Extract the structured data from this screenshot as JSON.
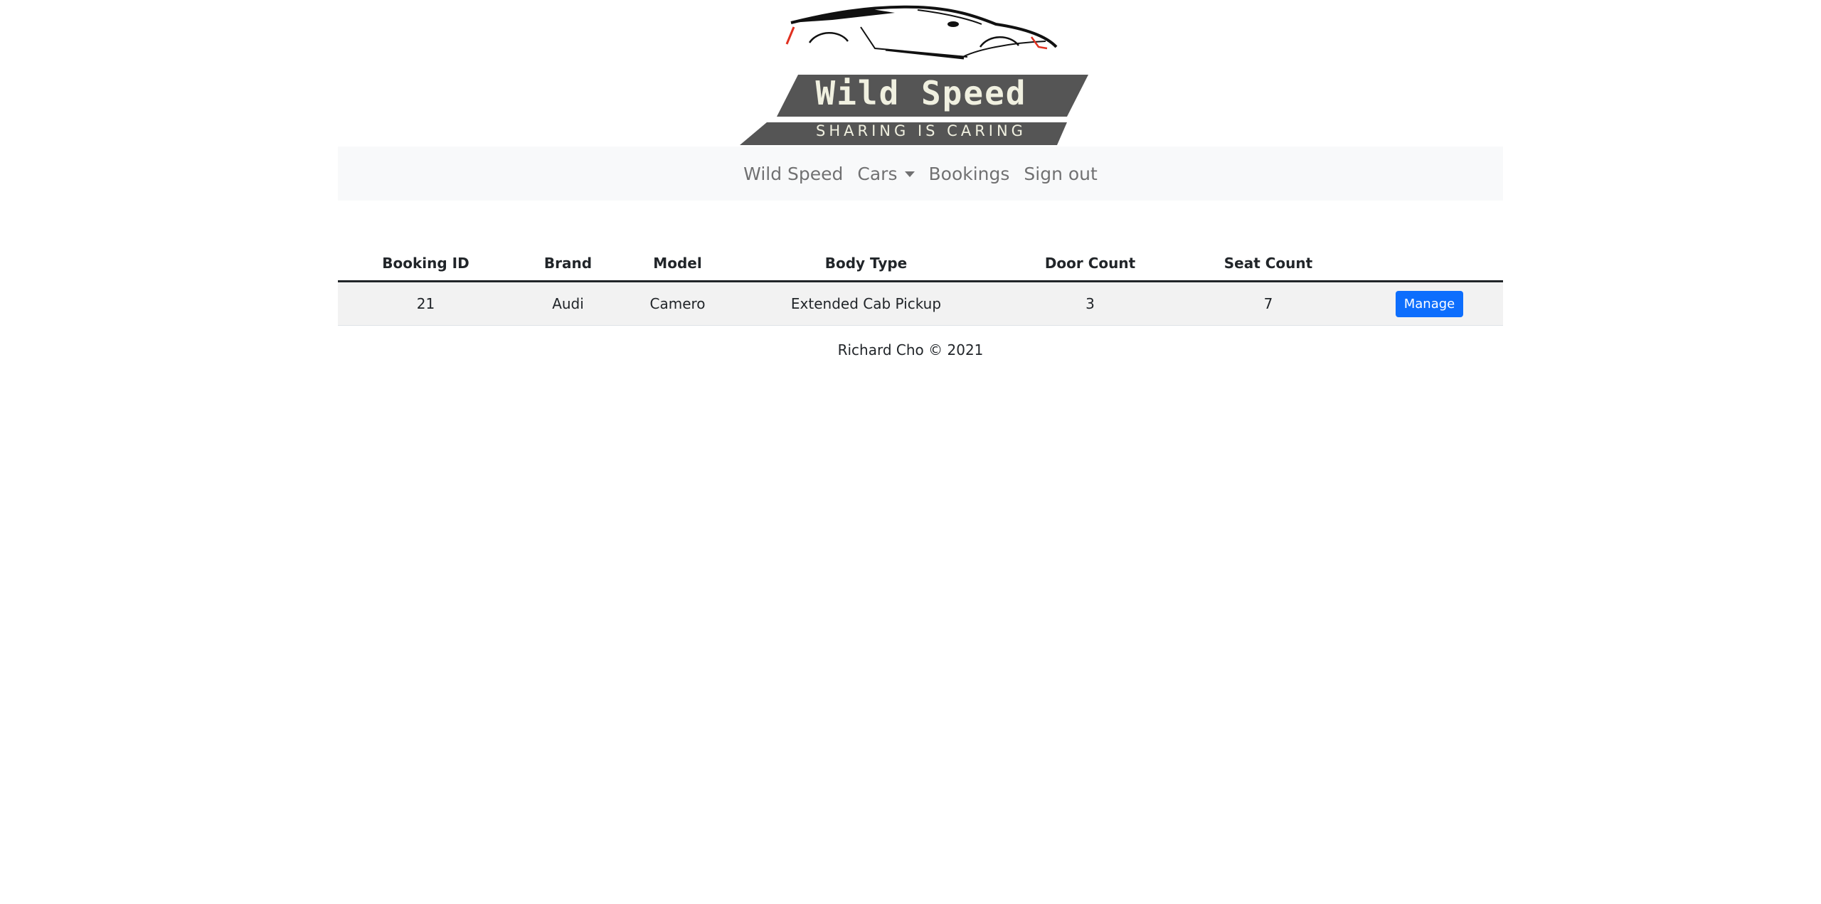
{
  "logo": {
    "title": "Wild Speed",
    "tagline": "SHARING IS CARING",
    "colors": {
      "banner": "#555555",
      "text": "#f0f0e0",
      "car_outline": "#111111",
      "accent": "#e03020"
    }
  },
  "navbar": {
    "items": [
      {
        "label": "Wild Speed"
      },
      {
        "label": "Cars",
        "has_dropdown": true
      },
      {
        "label": "Bookings"
      },
      {
        "label": "Sign out"
      }
    ]
  },
  "table": {
    "columns": [
      "Booking ID",
      "Brand",
      "Model",
      "Body Type",
      "Door Count",
      "Seat Count",
      ""
    ],
    "rows": [
      {
        "booking_id": "21",
        "brand": "Audi",
        "model": "Camero",
        "body_type": "Extended Cab Pickup",
        "door_count": "3",
        "seat_count": "7",
        "action_label": "Manage"
      }
    ]
  },
  "footer": {
    "text": "Richard Cho © 2021"
  },
  "colors": {
    "primary": "#0d6efd",
    "navbar_bg": "#f8f9fa",
    "row_bg": "#f2f2f2"
  }
}
